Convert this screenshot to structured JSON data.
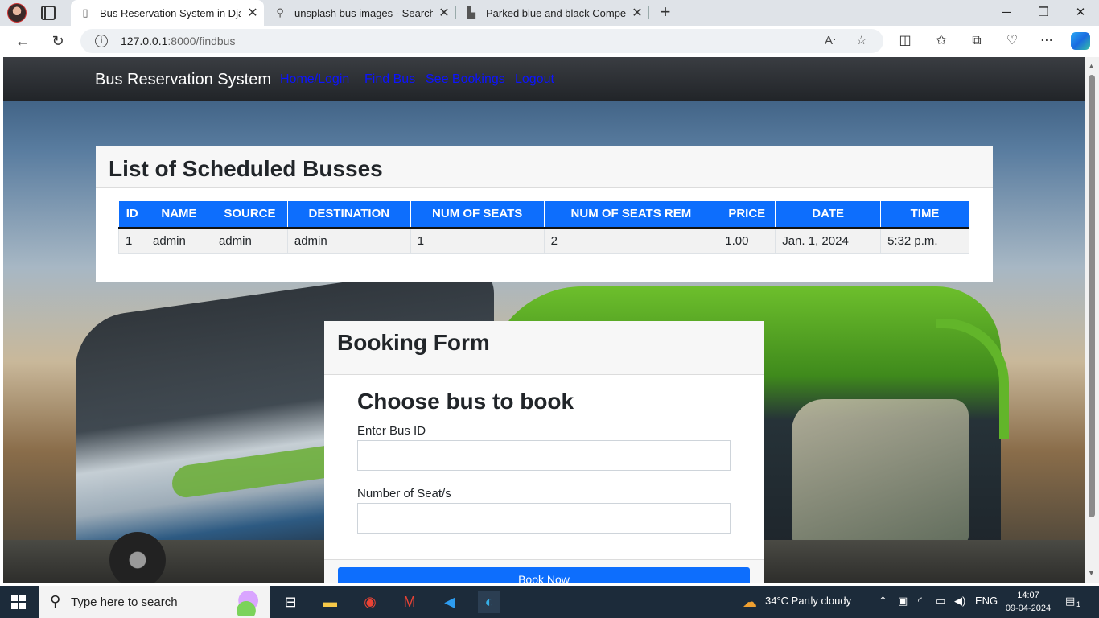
{
  "browser": {
    "tabs": [
      {
        "title": "Bus Reservation System in Djang",
        "active": true
      },
      {
        "title": "unsplash bus images - Search",
        "active": false
      },
      {
        "title": "Parked blue and black Compertu",
        "active": false
      }
    ],
    "url_host": "127.0.0.1",
    "url_path": ":8000/findbus"
  },
  "navbar": {
    "brand": "Bus Reservation System",
    "links": [
      "Home/Login",
      "Find Bus",
      "See Bookings",
      "Logout"
    ]
  },
  "bus_list": {
    "title": "List of Scheduled Busses",
    "columns": [
      "ID",
      "NAME",
      "SOURCE",
      "DESTINATION",
      "NUM OF SEATS",
      "NUM OF SEATS REM",
      "PRICE",
      "DATE",
      "TIME"
    ],
    "rows": [
      [
        "1",
        "admin",
        "admin",
        "admin",
        "1",
        "2",
        "1.00",
        "Jan. 1, 2024",
        "5:32 p.m."
      ]
    ]
  },
  "booking_form": {
    "header": "Booking Form",
    "heading": "Choose bus to book",
    "bus_id_label": "Enter Bus ID",
    "bus_id_value": "",
    "seats_label": "Number of Seat/s",
    "seats_value": "",
    "submit_label": "Book Now"
  },
  "taskbar": {
    "search_placeholder": "Type here to search",
    "weather": "34°C  Partly cloudy",
    "language": "ENG",
    "time": "14:07",
    "date": "09-04-2024",
    "notification_count": "1"
  },
  "colors": {
    "primary": "#0d6efd",
    "navbar": "#212428",
    "link": "#0d14ff"
  }
}
